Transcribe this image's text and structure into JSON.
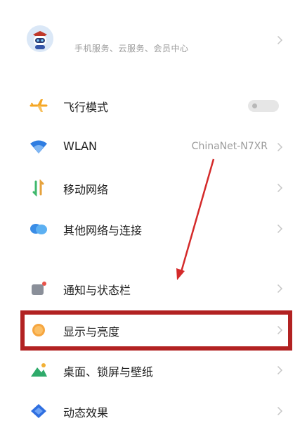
{
  "account": {
    "subtitle": "手机服务、云服务、会员中心"
  },
  "settings": {
    "airplane": {
      "label": "飞行模式",
      "enabled": false
    },
    "wlan": {
      "label": "WLAN",
      "value": "ChinaNet-N7XR"
    },
    "mobile": {
      "label": "移动网络"
    },
    "other_network": {
      "label": "其他网络与连接"
    },
    "notification": {
      "label": "通知与状态栏"
    },
    "display": {
      "label": "显示与亮度"
    },
    "wallpaper": {
      "label": "桌面、锁屏与壁纸"
    },
    "animation": {
      "label": "动态效果"
    }
  },
  "colors": {
    "highlight": "#b22222",
    "arrow": "#d42a2a",
    "airplane_icon": "#f5a623",
    "wifi_icon": "#2f7de1",
    "display_icon": "#f6a640"
  },
  "icons": {
    "avatar": "robot-avatar-icon",
    "airplane": "airplane-icon",
    "wlan": "wifi-icon",
    "mobile": "mobile-data-icon",
    "other_network": "cloud-link-icon",
    "notification": "notification-icon",
    "display": "brightness-icon",
    "wallpaper": "wallpaper-icon",
    "animation": "animation-diamond-icon",
    "chevron": "chevron-right-icon"
  }
}
